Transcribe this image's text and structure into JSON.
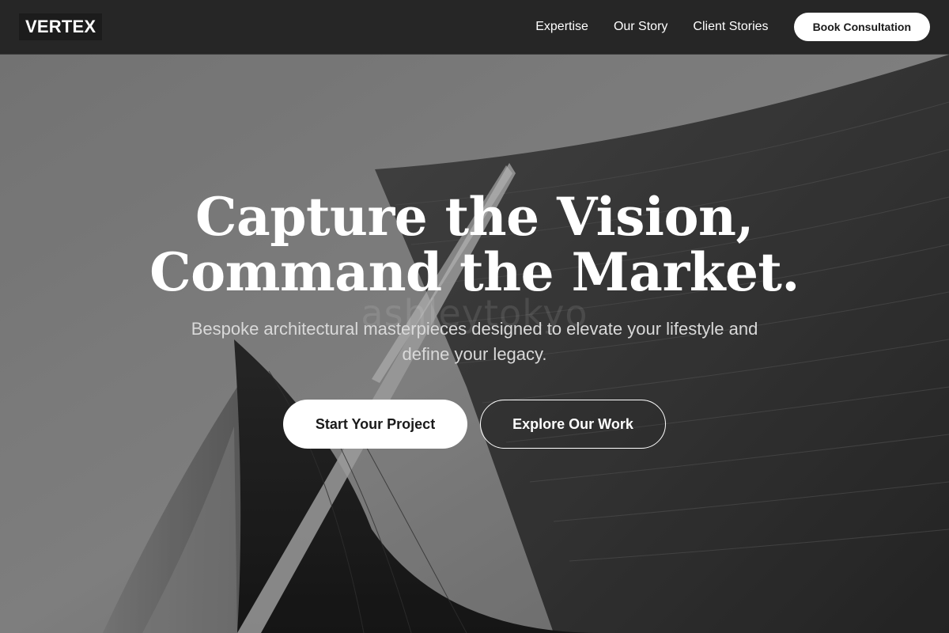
{
  "nav": {
    "logo": "VERTEX",
    "links": [
      "Expertise",
      "Our Story",
      "Client Stories"
    ],
    "cta": "Book Consultation"
  },
  "hero": {
    "headline_line1": "Capture the Vision,",
    "headline_line2": "Command the Market.",
    "sub_line1": "Bespoke architectural masterpieces designed to elevate your lifestyle and",
    "sub_line2": "define your legacy.",
    "primary_button": "Start Your Project",
    "secondary_button": "Explore Our Work",
    "watermark": "ashleytokyo",
    "background_image": "black-and-white-curved-architecture-facade"
  },
  "colors": {
    "nav_bg": "#262626",
    "accent": "#ffffff",
    "text_dark": "#1a1a1a"
  }
}
